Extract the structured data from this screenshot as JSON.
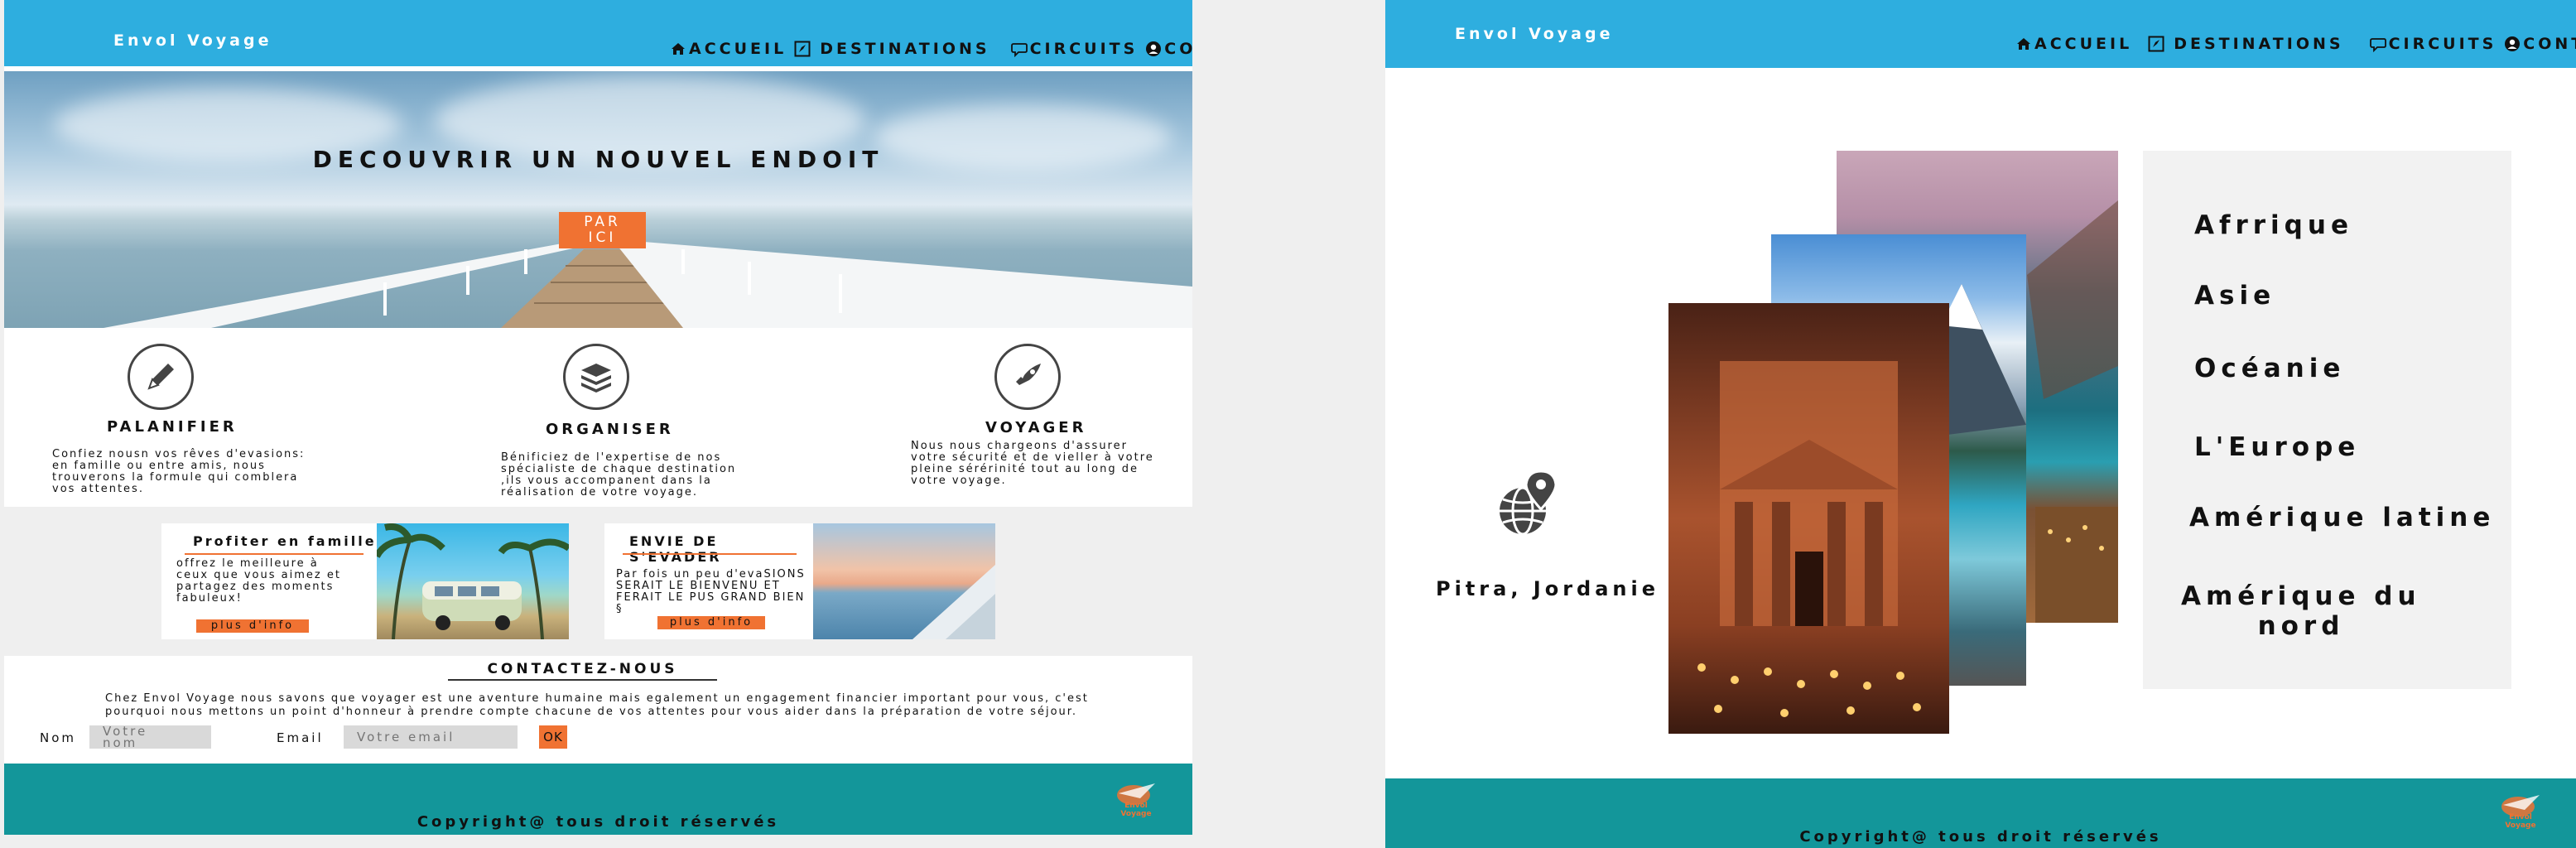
{
  "home": {
    "brand": "Envol Voyage",
    "nav": [
      {
        "label": "ACCUEIL",
        "icon": "home-icon"
      },
      {
        "label": "DESTINATIONS",
        "icon": "rocket-icon"
      },
      {
        "label": "CIRCUITS",
        "icon": "chat-bubble-icon"
      },
      {
        "label": "CONTACT",
        "icon": "user-icon"
      }
    ],
    "hero": {
      "title": "DECOUVRIR UN NOUVEL ENDOIT",
      "button_line1": "PAR",
      "button_line2": "ICI"
    },
    "features": [
      {
        "title": "PALANIFIER",
        "icon": "pencil-icon",
        "lines": [
          "Confiez nousn vos rêves d'evasions:",
          "en famille ou entre amis, nous",
          "trouverons la formule qui comblera",
          "vos attentes."
        ]
      },
      {
        "title": "ORGANISER",
        "icon": "layers-icon",
        "lines": [
          "Bénificiez de l'expertise de nos",
          "spécialiste de chaque destination",
          ",ils vous accompanent dans la",
          "réalisation de votre voyage."
        ]
      },
      {
        "title": "VOYAGER",
        "icon": "rocket-icon",
        "lines": [
          "Nous nous chargeons d'assurer",
          "votre sécurité et de vieller à votre",
          "pleine sérérinité tout au long de",
          "votre voyage."
        ]
      }
    ],
    "promos": [
      {
        "title": "Profiter en famille",
        "lines": [
          "offrez  le meilleure à",
          "ceux que vous aimez et",
          "partagez des moments",
          "fabuleux!"
        ],
        "button": "plus d'info"
      },
      {
        "title": "ENVIE DE S'EVADER",
        "lines": [
          "Par fois un peu d'evaSIONS",
          "SERAIT LE BIENVENU ET",
          "FERAIT LE PUS GRAND BIEN §"
        ],
        "button": "plus d'info"
      }
    ],
    "contact": {
      "title": "CONTACTEZ-NOUS",
      "text_line1": "Chez Envol Voyage nous savons que voyager est une aventure humaine mais egalement un engagement financier important pour vous, c'est",
      "text_line2": "pourquoi nous mettons un point d'honneur à prendre compte chacune de vos attentes pour vous aider dans la préparation de votre séjour.",
      "name_label": "Nom",
      "name_placeholder": "Votre\nnom",
      "email_label": "Email",
      "email_placeholder": "Votre email",
      "submit": "OK"
    },
    "footer": {
      "copyright": "Copyright@ tous droit réservés",
      "logo_text": "Envol Voyage"
    }
  },
  "destinations": {
    "brand": "Envol Voyage",
    "nav": [
      {
        "label": "ACCUEIL",
        "icon": "home-icon"
      },
      {
        "label": "DESTINATIONS",
        "icon": "rocket-icon"
      },
      {
        "label": "CIRCUITS",
        "icon": "chat-bubble-icon"
      },
      {
        "label": "CONTACT",
        "icon": "user-icon"
      }
    ],
    "caption": "Pitra, Jordanie",
    "regions": [
      "Afrrique",
      "Asie",
      "Océanie",
      "L'Europe",
      "Amérique latine",
      "Amérique du",
      "nord"
    ],
    "footer": {
      "copyright": "Copyright@ tous droit réservés",
      "logo_text": "Envol Voyage"
    }
  },
  "colors": {
    "header": "#2eaedf",
    "accent": "#f07232",
    "footer": "#13969a"
  }
}
